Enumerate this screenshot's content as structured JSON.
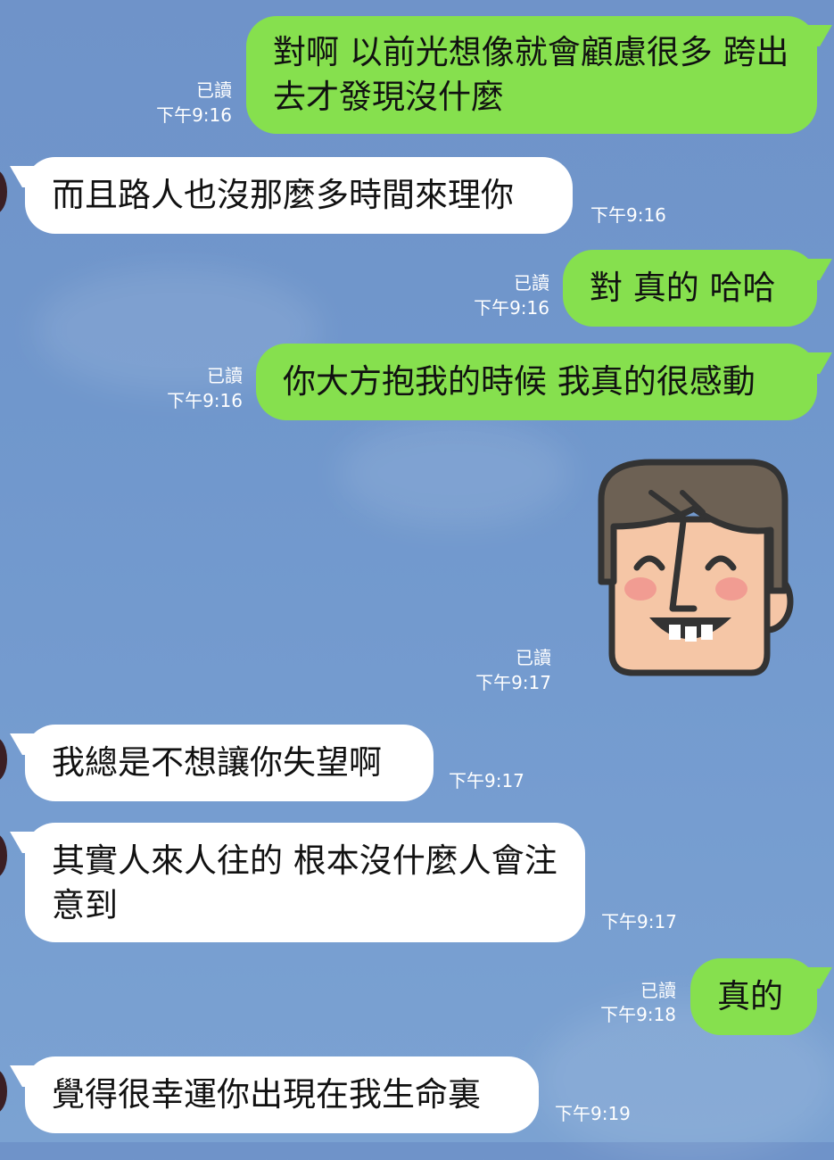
{
  "colors": {
    "sent_bubble": "#86e04e",
    "recv_bubble": "#ffffff",
    "background": "#7097cc",
    "meta_text": "#ffffff"
  },
  "messages": [
    {
      "side": "sent",
      "text": "對啊 以前光想像就會顧慮很多 跨出去才發現沒什麼",
      "read": "已讀",
      "time": "下午9:16"
    },
    {
      "side": "recv",
      "text": "而且路人也沒那麼多時間來理你",
      "time": "下午9:16"
    },
    {
      "side": "sent",
      "text": "對 真的 哈哈",
      "read": "已讀",
      "time": "下午9:16"
    },
    {
      "side": "sent",
      "text": "你大方抱我的時候 我真的很感動",
      "read": "已讀",
      "time": "下午9:16"
    },
    {
      "side": "sent",
      "sticker": "smiling-man-face-sticker",
      "read": "已讀",
      "time": "下午9:17"
    },
    {
      "side": "recv",
      "text": "我總是不想讓你失望啊",
      "time": "下午9:17"
    },
    {
      "side": "recv",
      "text": "其實人來人往的 根本沒什麼人會注意到",
      "time": "下午9:17"
    },
    {
      "side": "sent",
      "text": "真的",
      "read": "已讀",
      "time": "下午9:18"
    },
    {
      "side": "recv",
      "text": "覺得很幸運你出現在我生命裏",
      "time": "下午9:19"
    }
  ]
}
